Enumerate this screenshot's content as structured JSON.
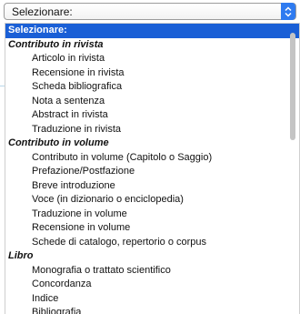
{
  "select": {
    "value": "Selezionare:",
    "arrow_icon": "chevron-up-down-icon"
  },
  "dropdown": {
    "options": [
      {
        "type": "selected",
        "label": "Selezionare:"
      },
      {
        "type": "group",
        "label": "Contributo in rivista"
      },
      {
        "type": "item",
        "label": "Articolo in rivista"
      },
      {
        "type": "item",
        "label": "Recensione in rivista"
      },
      {
        "type": "item",
        "label": "Scheda bibliografica"
      },
      {
        "type": "item",
        "label": "Nota a sentenza"
      },
      {
        "type": "item",
        "label": "Abstract in rivista"
      },
      {
        "type": "item",
        "label": "Traduzione in rivista"
      },
      {
        "type": "group",
        "label": "Contributo in volume"
      },
      {
        "type": "item",
        "label": "Contributo in volume (Capitolo o Saggio)"
      },
      {
        "type": "item",
        "label": "Prefazione/Postfazione"
      },
      {
        "type": "item",
        "label": "Breve introduzione"
      },
      {
        "type": "item",
        "label": "Voce (in dizionario o enciclopedia)"
      },
      {
        "type": "item",
        "label": "Traduzione in volume"
      },
      {
        "type": "item",
        "label": "Recensione in volume"
      },
      {
        "type": "item",
        "label": "Schede di catalogo, repertorio o corpus"
      },
      {
        "type": "group",
        "label": "Libro"
      },
      {
        "type": "item",
        "label": "Monografia o trattato scientifico"
      },
      {
        "type": "item",
        "label": "Concordanza"
      },
      {
        "type": "item",
        "label": "Indice"
      },
      {
        "type": "item",
        "label": "Bibliografia"
      }
    ]
  },
  "colors": {
    "selected_bg": "#1a5fd6",
    "arrow_bg": "#2f7bf0"
  }
}
